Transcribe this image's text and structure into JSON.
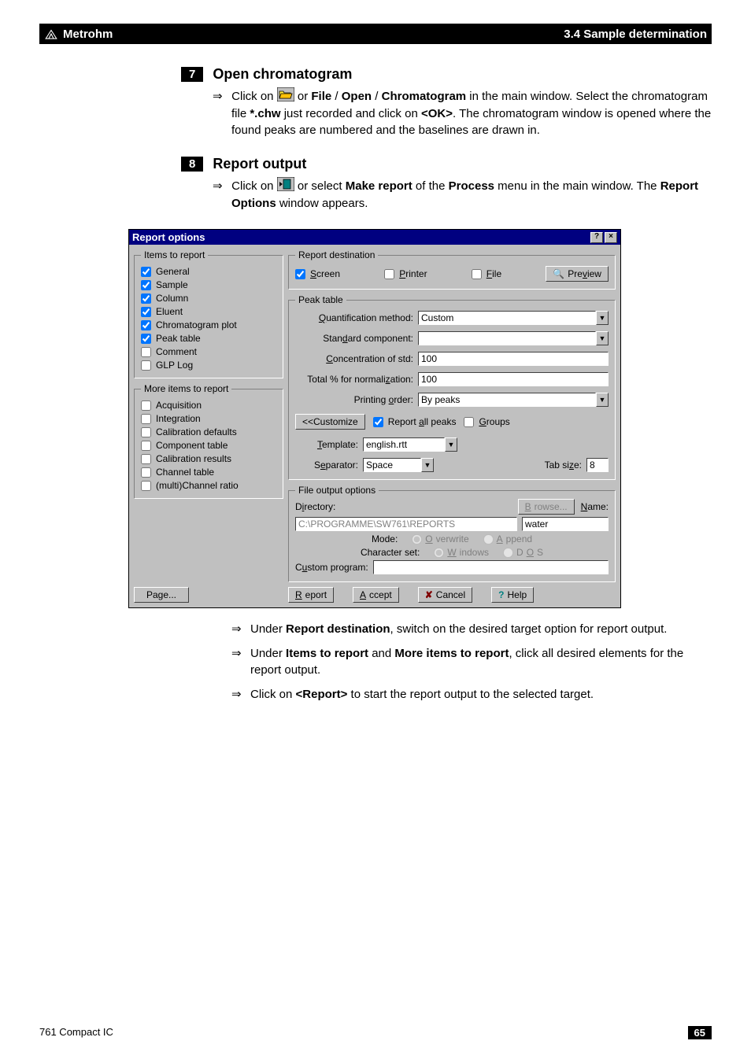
{
  "header": {
    "brand": "Metrohm",
    "section": "3.4  Sample determination"
  },
  "s7": {
    "num": "7",
    "title": "Open chromatogram",
    "text": {
      "a": "Click on ",
      "b": " or ",
      "file": "File",
      "open": "Open",
      "chrom": "Chromatogram",
      "c": " in the main window. Select the chromatogram file ",
      "ext": "*.chw",
      "d": " just recorded and click on ",
      "ok": "<OK>",
      "e": ". The chromatogram window is opened where the found peaks are numbered and the baselines are drawn in."
    }
  },
  "s8": {
    "num": "8",
    "title": "Report output",
    "text": {
      "a": "Click on ",
      "b": " or select ",
      "mk": "Make report",
      "c": " of the ",
      "proc": "Process",
      "d": " menu in the main window. The ",
      "ro": "Report Options",
      "e": " window appears."
    }
  },
  "dialog": {
    "title": "Report options",
    "items": {
      "legend": "Items to report",
      "general": "General",
      "sample": "Sample",
      "column": "Column",
      "eluent": "Eluent",
      "chromplot": "Chromatogram plot",
      "peaktable": "Peak table",
      "comment": "Comment",
      "glp": "GLP Log"
    },
    "more": {
      "legend": "More items to report",
      "acquisition": "Acquisition",
      "integration": "Integration",
      "caldef": "Calibration defaults",
      "comptable": "Component table",
      "calres": "Calibration results",
      "chantable": "Channel table",
      "multichan": "(multi)Channel ratio"
    },
    "dest": {
      "legend": "Report destination",
      "screen": "Screen",
      "printer": "Printer",
      "file": "File",
      "preview": "Preview"
    },
    "peak": {
      "legend": "Peak table",
      "qm_label": "Quantification method:",
      "qm_value": "Custom",
      "sc_label": "Standard component:",
      "sc_value": "",
      "cs_label": "Concentration of std:",
      "cs_value": "100",
      "tn_label": "Total % for normalization:",
      "tn_value": "100",
      "po_label": "Printing order:",
      "po_value": "By peaks",
      "customize": "<<Customize",
      "rap": "Report all peaks",
      "groups": "Groups",
      "tpl_label": "Template:",
      "tpl_value": "english.rtt",
      "sep_label": "Separator:",
      "sep_value": "Space",
      "tab_label": "Tab size:",
      "tab_value": "8"
    },
    "fileout": {
      "legend": "File output options",
      "dir_label": "Directory:",
      "browse": "Browse...",
      "name_label": "Name:",
      "dir_value": "C:\\PROGRAMME\\SW761\\REPORTS",
      "name_value": "water",
      "mode_label": "Mode:",
      "overwrite": "Overwrite",
      "append": "Append",
      "cs_label": "Character set:",
      "windows": "Windows",
      "dos": "DOS",
      "cp_label": "Custom program:"
    },
    "buttons": {
      "page": "Page...",
      "report": "Report",
      "accept": "Accept",
      "cancel": "Cancel",
      "help": "Help"
    }
  },
  "notes": {
    "n1a": "Under ",
    "rd": "Report destination",
    "n1b": ", switch on the desired target option for report output.",
    "n2a": "Under ",
    "itr": "Items to report",
    "and": " and ",
    "mitr": "More items to report",
    "n2b": ", click all desired elements for the report output.",
    "n3a": "Click on ",
    "rep": "<Report>",
    "n3b": " to start the report output to the selected target."
  },
  "footer": {
    "product": "761 Compact IC",
    "page": "65"
  }
}
